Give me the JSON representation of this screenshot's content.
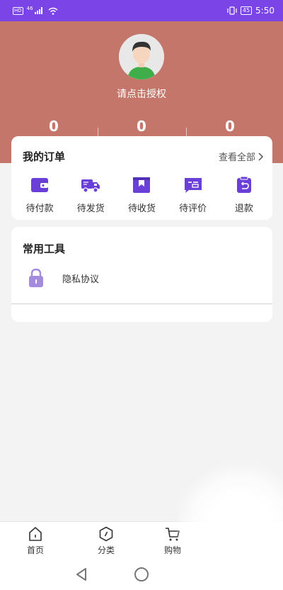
{
  "status_bar": {
    "hd": "HD",
    "signal": "46",
    "battery": "45",
    "time": "5:50"
  },
  "profile": {
    "auth_label": "请点击授权",
    "stats": [
      "0",
      "0",
      "0"
    ]
  },
  "orders": {
    "title": "我的订单",
    "view_all": "查看全部",
    "items": [
      {
        "label": "待付款",
        "icon": "wallet-icon"
      },
      {
        "label": "待发货",
        "icon": "truck-icon"
      },
      {
        "label": "待收货",
        "icon": "package-icon"
      },
      {
        "label": "待评价",
        "icon": "comment-icon"
      },
      {
        "label": "退款",
        "icon": "refund-icon"
      }
    ]
  },
  "tools": {
    "title": "常用工具",
    "items": [
      {
        "label": "隐私协议",
        "icon": "lock-icon"
      }
    ]
  },
  "tab_bar": {
    "items": [
      {
        "label": "首页",
        "icon": "home-icon"
      },
      {
        "label": "分类",
        "icon": "category-icon"
      },
      {
        "label": "购物",
        "icon": "cart-icon"
      }
    ]
  },
  "colors": {
    "status_bar": "#7b44e6",
    "header": "#c5766b",
    "accent_purple": "#6a3fd8",
    "lock_purple": "#a48be0"
  }
}
